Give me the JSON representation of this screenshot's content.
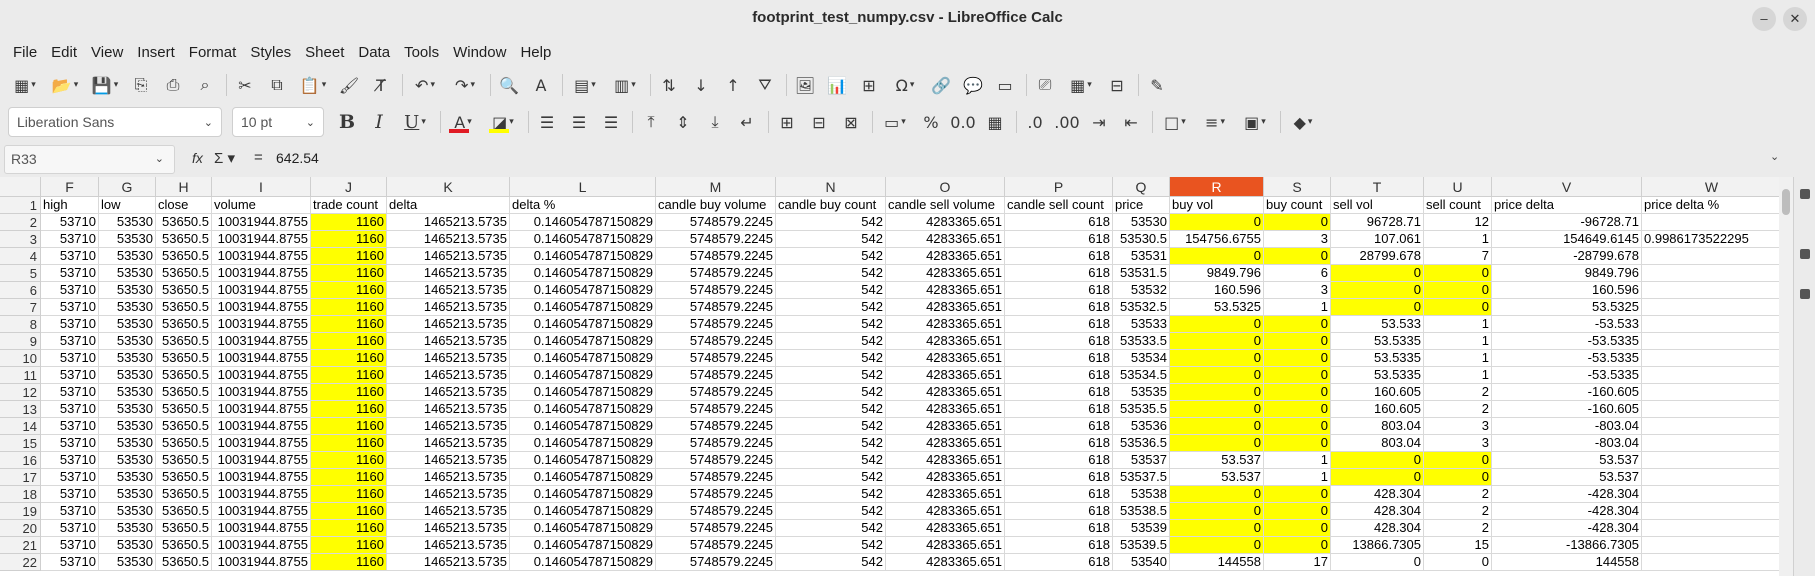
{
  "window": {
    "title": "footprint_test_numpy.csv - LibreOffice Calc",
    "minimize": "–",
    "close": "✕"
  },
  "menu": [
    "File",
    "Edit",
    "View",
    "Insert",
    "Format",
    "Styles",
    "Sheet",
    "Data",
    "Tools",
    "Window",
    "Help"
  ],
  "toolbar2": {
    "font_name": "Liberation Sans",
    "font_size": "10 pt",
    "font_color_bar": "#e01b24",
    "highlight_bar": "#ffff00"
  },
  "formula": {
    "cell_ref": "R33",
    "fx": "fx",
    "sigma": "Σ",
    "equals": "=",
    "value": "642.54"
  },
  "grid": {
    "selected_column": "R",
    "highlight_color": "#ffff00",
    "columns": [
      {
        "letter": "F"
      },
      {
        "letter": "G"
      },
      {
        "letter": "H"
      },
      {
        "letter": "I"
      },
      {
        "letter": "J"
      },
      {
        "letter": "K"
      },
      {
        "letter": "L"
      },
      {
        "letter": "M"
      },
      {
        "letter": "N"
      },
      {
        "letter": "O"
      },
      {
        "letter": "P"
      },
      {
        "letter": "Q"
      },
      {
        "letter": "R"
      },
      {
        "letter": "S"
      },
      {
        "letter": "T"
      },
      {
        "letter": "U"
      },
      {
        "letter": "V"
      },
      {
        "letter": "W"
      }
    ],
    "header_row": [
      "high",
      "low",
      "close",
      "volume",
      "trade count",
      "delta",
      "delta %",
      "candle buy volume",
      "candle buy count",
      "candle sell volume",
      "candle sell count",
      "price",
      "buy vol",
      "buy count",
      "sell vol",
      "sell count",
      "price delta",
      "price delta %"
    ],
    "common": {
      "high": "53710",
      "low": "53530",
      "close": "53650.5",
      "volume": "10031944.8755",
      "trade_count": "1160",
      "delta": "1465213.5735",
      "delta_pct": "0.146054787150829",
      "candle_buy_volume": "5748579.2245",
      "candle_buy_count": "542",
      "candle_sell_volume": "4283365.651",
      "candle_sell_count": "618"
    },
    "rows": [
      {
        "n": "2",
        "price": "53530",
        "buy_vol": "0",
        "buy_count": "0",
        "sell_vol": "96728.71",
        "sell_count": "12",
        "price_delta": "-96728.71",
        "price_delta_pct": "",
        "hl_buy": true,
        "hl_sell": false
      },
      {
        "n": "3",
        "price": "53530.5",
        "buy_vol": "154756.6755",
        "buy_count": "3",
        "sell_vol": "107.061",
        "sell_count": "1",
        "price_delta": "154649.6145",
        "price_delta_pct": "0.9986173522295",
        "hl_buy": false,
        "hl_sell": false
      },
      {
        "n": "4",
        "price": "53531",
        "buy_vol": "0",
        "buy_count": "0",
        "sell_vol": "28799.678",
        "sell_count": "7",
        "price_delta": "-28799.678",
        "price_delta_pct": "",
        "hl_buy": true,
        "hl_sell": false
      },
      {
        "n": "5",
        "price": "53531.5",
        "buy_vol": "9849.796",
        "buy_count": "6",
        "sell_vol": "0",
        "sell_count": "0",
        "price_delta": "9849.796",
        "price_delta_pct": "",
        "hl_buy": false,
        "hl_sell": true
      },
      {
        "n": "6",
        "price": "53532",
        "buy_vol": "160.596",
        "buy_count": "3",
        "sell_vol": "0",
        "sell_count": "0",
        "price_delta": "160.596",
        "price_delta_pct": "",
        "hl_buy": false,
        "hl_sell": true
      },
      {
        "n": "7",
        "price": "53532.5",
        "buy_vol": "53.5325",
        "buy_count": "1",
        "sell_vol": "0",
        "sell_count": "0",
        "price_delta": "53.5325",
        "price_delta_pct": "",
        "hl_buy": false,
        "hl_sell": true
      },
      {
        "n": "8",
        "price": "53533",
        "buy_vol": "0",
        "buy_count": "0",
        "sell_vol": "53.533",
        "sell_count": "1",
        "price_delta": "-53.533",
        "price_delta_pct": "",
        "hl_buy": true,
        "hl_sell": false
      },
      {
        "n": "9",
        "price": "53533.5",
        "buy_vol": "0",
        "buy_count": "0",
        "sell_vol": "53.5335",
        "sell_count": "1",
        "price_delta": "-53.5335",
        "price_delta_pct": "",
        "hl_buy": true,
        "hl_sell": false
      },
      {
        "n": "10",
        "price": "53534",
        "buy_vol": "0",
        "buy_count": "0",
        "sell_vol": "53.5335",
        "sell_count": "1",
        "price_delta": "-53.5335",
        "price_delta_pct": "",
        "hl_buy": true,
        "hl_sell": false
      },
      {
        "n": "11",
        "price": "53534.5",
        "buy_vol": "0",
        "buy_count": "0",
        "sell_vol": "53.5335",
        "sell_count": "1",
        "price_delta": "-53.5335",
        "price_delta_pct": "",
        "hl_buy": true,
        "hl_sell": false
      },
      {
        "n": "12",
        "price": "53535",
        "buy_vol": "0",
        "buy_count": "0",
        "sell_vol": "160.605",
        "sell_count": "2",
        "price_delta": "-160.605",
        "price_delta_pct": "",
        "hl_buy": true,
        "hl_sell": false
      },
      {
        "n": "13",
        "price": "53535.5",
        "buy_vol": "0",
        "buy_count": "0",
        "sell_vol": "160.605",
        "sell_count": "2",
        "price_delta": "-160.605",
        "price_delta_pct": "",
        "hl_buy": true,
        "hl_sell": false
      },
      {
        "n": "14",
        "price": "53536",
        "buy_vol": "0",
        "buy_count": "0",
        "sell_vol": "803.04",
        "sell_count": "3",
        "price_delta": "-803.04",
        "price_delta_pct": "",
        "hl_buy": true,
        "hl_sell": false
      },
      {
        "n": "15",
        "price": "53536.5",
        "buy_vol": "0",
        "buy_count": "0",
        "sell_vol": "803.04",
        "sell_count": "3",
        "price_delta": "-803.04",
        "price_delta_pct": "",
        "hl_buy": true,
        "hl_sell": false
      },
      {
        "n": "16",
        "price": "53537",
        "buy_vol": "53.537",
        "buy_count": "1",
        "sell_vol": "0",
        "sell_count": "0",
        "price_delta": "53.537",
        "price_delta_pct": "",
        "hl_buy": false,
        "hl_sell": true
      },
      {
        "n": "17",
        "price": "53537.5",
        "buy_vol": "53.537",
        "buy_count": "1",
        "sell_vol": "0",
        "sell_count": "0",
        "price_delta": "53.537",
        "price_delta_pct": "",
        "hl_buy": false,
        "hl_sell": true
      },
      {
        "n": "18",
        "price": "53538",
        "buy_vol": "0",
        "buy_count": "0",
        "sell_vol": "428.304",
        "sell_count": "2",
        "price_delta": "-428.304",
        "price_delta_pct": "",
        "hl_buy": true,
        "hl_sell": false
      },
      {
        "n": "19",
        "price": "53538.5",
        "buy_vol": "0",
        "buy_count": "0",
        "sell_vol": "428.304",
        "sell_count": "2",
        "price_delta": "-428.304",
        "price_delta_pct": "",
        "hl_buy": true,
        "hl_sell": false
      },
      {
        "n": "20",
        "price": "53539",
        "buy_vol": "0",
        "buy_count": "0",
        "sell_vol": "428.304",
        "sell_count": "2",
        "price_delta": "-428.304",
        "price_delta_pct": "",
        "hl_buy": true,
        "hl_sell": false
      },
      {
        "n": "21",
        "price": "53539.5",
        "buy_vol": "0",
        "buy_count": "0",
        "sell_vol": "13866.7305",
        "sell_count": "15",
        "price_delta": "-13866.7305",
        "price_delta_pct": "",
        "hl_buy": true,
        "hl_sell": false
      },
      {
        "n": "22",
        "price": "53540",
        "buy_vol": "144558",
        "buy_count": "17",
        "sell_vol": "0",
        "sell_count": "0",
        "price_delta": "144558",
        "price_delta_pct": "",
        "hl_buy": false,
        "hl_sell": false
      }
    ]
  }
}
